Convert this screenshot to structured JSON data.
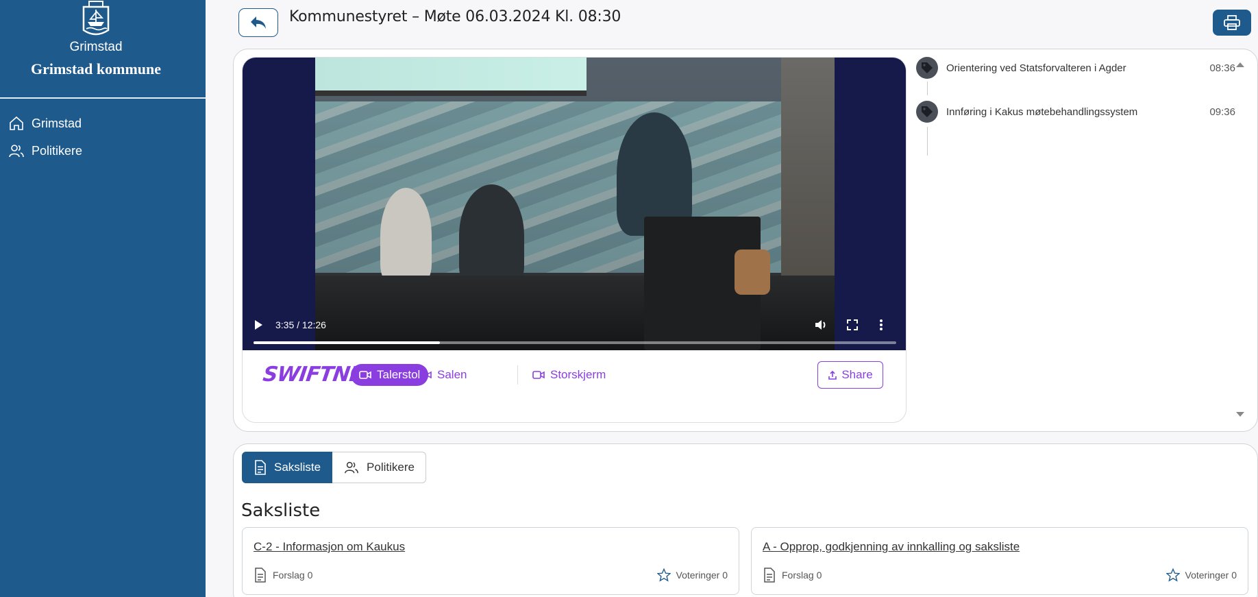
{
  "sidebar": {
    "city": "Grimstad",
    "name": "Grimstad kommune",
    "items": [
      {
        "label": "Grimstad",
        "icon": "home-icon"
      },
      {
        "label": "Politikere",
        "icon": "users-icon"
      }
    ]
  },
  "header": {
    "title": "Kommunestyret – Møte 06.03.2024 Kl. 08:30"
  },
  "player": {
    "time": "3:35 / 12:26",
    "progress": 0.29,
    "brand": "SWIFTNER",
    "cameras": [
      {
        "label": "Talerstol",
        "active": true
      },
      {
        "label": "Salen",
        "active": false
      },
      {
        "label": "Storskjerm",
        "active": false
      }
    ],
    "share_label": "Share"
  },
  "chapters": [
    {
      "title": "Orientering ved Statsforvalteren i Agder",
      "time": "08:36"
    },
    {
      "title": "Innføring i Kakus møtebehandlingssystem",
      "time": "09:36"
    }
  ],
  "tabs": [
    {
      "label": "Saksliste",
      "icon": "document-icon",
      "active": true
    },
    {
      "label": "Politikere",
      "icon": "users-icon",
      "active": false
    }
  ],
  "section_title": "Saksliste",
  "agenda": [
    {
      "title": "C-2 - Informasjon om Kaukus",
      "forslag": "Forslag 0",
      "voteringer": "Voteringer 0"
    },
    {
      "title": "A - Opprop, godkjenning av innkalling og saksliste",
      "forslag": "Forslag 0",
      "voteringer": "Voteringer 0"
    }
  ],
  "colors": {
    "sidebar": "#1f5a8c",
    "accent_purple": "#8a3ee0",
    "video_bg": "#151a4a"
  }
}
